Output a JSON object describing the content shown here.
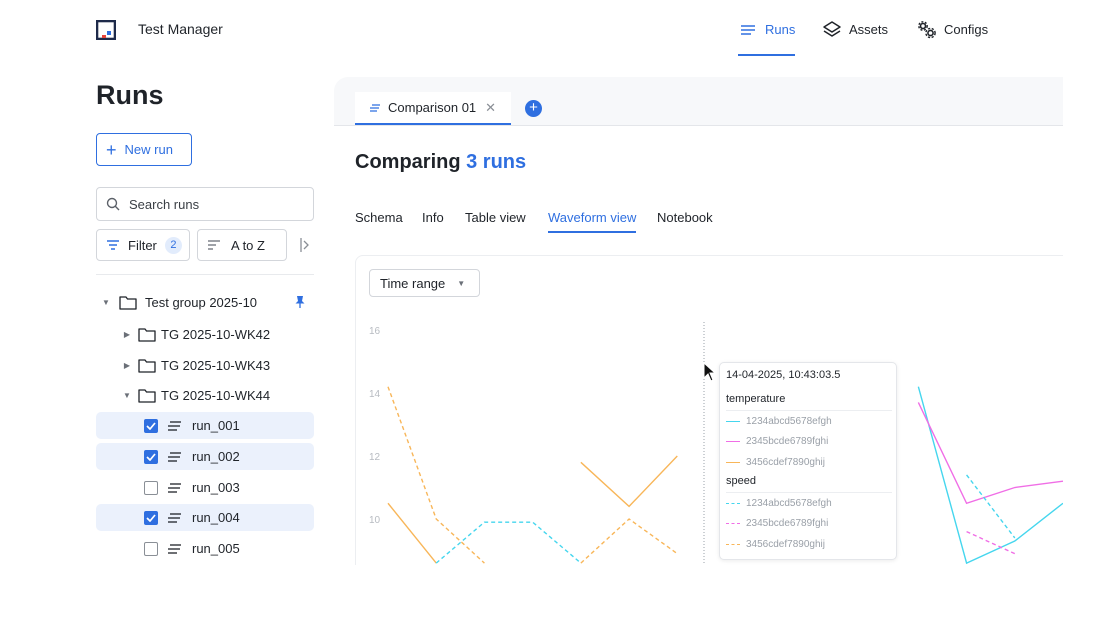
{
  "app": {
    "title": "Test Manager"
  },
  "nav": [
    {
      "label": "Runs",
      "icon": "runs-icon",
      "active": true
    },
    {
      "label": "Assets",
      "icon": "layers-icon",
      "active": false
    },
    {
      "label": "Configs",
      "icon": "gears-icon",
      "active": false
    }
  ],
  "sidebar": {
    "title": "Runs",
    "new_run_label": "New run",
    "search_placeholder": "Search runs",
    "filter_label": "Filter",
    "filter_count": "2",
    "sort_label": "A to Z",
    "tree": [
      {
        "label": "Test group 2025-10",
        "type": "group",
        "expanded": true,
        "pinned": true
      },
      {
        "label": "TG 2025-10-WK42",
        "type": "folder",
        "expanded": false
      },
      {
        "label": "TG 2025-10-WK43",
        "type": "folder",
        "expanded": false
      },
      {
        "label": "TG 2025-10-WK44",
        "type": "folder",
        "expanded": true
      }
    ],
    "runs": [
      {
        "label": "run_001",
        "checked": true
      },
      {
        "label": "run_002",
        "checked": true
      },
      {
        "label": "run_003",
        "checked": false
      },
      {
        "label": "run_004",
        "checked": true
      },
      {
        "label": "run_005",
        "checked": false
      }
    ]
  },
  "main": {
    "doc_tab_label": "Comparison 01",
    "title_prefix": "Comparing",
    "title_count": "3 runs",
    "view_tabs": [
      {
        "label": "Schema",
        "active": false
      },
      {
        "label": "Info",
        "active": false
      },
      {
        "label": "Table view",
        "active": false
      },
      {
        "label": "Waveform view",
        "active": true
      },
      {
        "label": "Notebook",
        "active": false
      }
    ],
    "time_range_label": "Time range"
  },
  "colors": {
    "accent": "#2f6fe0",
    "series_cyan": "#45d6ee",
    "series_magenta": "#f06ee6",
    "series_orange": "#f8b659"
  },
  "tooltip": {
    "timestamp": "14-04-2025, 10:43:03.5",
    "groups": [
      {
        "name": "temperature",
        "items": [
          {
            "label": "1234abcd5678efgh",
            "color": "#45d6ee",
            "dash": false
          },
          {
            "label": "2345bcde6789fghi",
            "color": "#f06ee6",
            "dash": false
          },
          {
            "label": "3456cdef7890ghij",
            "color": "#f8b659",
            "dash": false
          }
        ]
      },
      {
        "name": "speed",
        "items": [
          {
            "label": "1234abcd5678efgh",
            "color": "#45d6ee",
            "dash": true
          },
          {
            "label": "2345bcde6789fghi",
            "color": "#f06ee6",
            "dash": true
          },
          {
            "label": "3456cdef7890ghij",
            "color": "#f8b659",
            "dash": true
          }
        ]
      }
    ]
  },
  "chart_data": {
    "type": "line",
    "y_ticks": [
      "16",
      "14",
      "12",
      "10"
    ],
    "ylim": [
      8.6,
      16
    ],
    "x": [
      0,
      1,
      2,
      3,
      4,
      5,
      6,
      7,
      8,
      9,
      10,
      11,
      12,
      13,
      14
    ],
    "series": [
      {
        "name": "1234abcd5678efgh",
        "group": "temperature",
        "color": "#45d6ee",
        "dash": false,
        "values": [
          null,
          null,
          null,
          null,
          null,
          null,
          null,
          null,
          null,
          null,
          null,
          14.2,
          8.6,
          9.3,
          10.5
        ]
      },
      {
        "name": "2345bcde6789fghi",
        "group": "temperature",
        "color": "#f06ee6",
        "dash": false,
        "values": [
          null,
          null,
          null,
          null,
          null,
          null,
          null,
          null,
          null,
          null,
          null,
          13.7,
          10.5,
          11.0,
          11.2
        ]
      },
      {
        "name": "3456cdef7890ghij",
        "group": "temperature",
        "color": "#f8b659",
        "dash": false,
        "values": [
          10.5,
          8.6,
          null,
          null,
          11.8,
          10.4,
          12.0,
          null,
          null,
          null,
          null,
          9.9,
          null,
          null,
          null
        ]
      },
      {
        "name": "1234abcd5678efgh",
        "group": "speed",
        "color": "#45d6ee",
        "dash": true,
        "values": [
          null,
          8.6,
          9.9,
          9.9,
          8.6,
          null,
          null,
          null,
          null,
          null,
          null,
          null,
          11.4,
          9.4,
          null
        ]
      },
      {
        "name": "2345bcde6789fghi",
        "group": "speed",
        "color": "#f06ee6",
        "dash": true,
        "values": [
          null,
          null,
          null,
          null,
          null,
          null,
          null,
          null,
          null,
          null,
          null,
          null,
          9.6,
          8.9,
          null
        ]
      },
      {
        "name": "3456cdef7890ghij",
        "group": "speed",
        "color": "#f8b659",
        "dash": true,
        "values": [
          14.2,
          10.0,
          8.6,
          null,
          8.6,
          10.0,
          8.9,
          null,
          null,
          null,
          null,
          null,
          null,
          null,
          null
        ]
      }
    ],
    "grid": false
  }
}
